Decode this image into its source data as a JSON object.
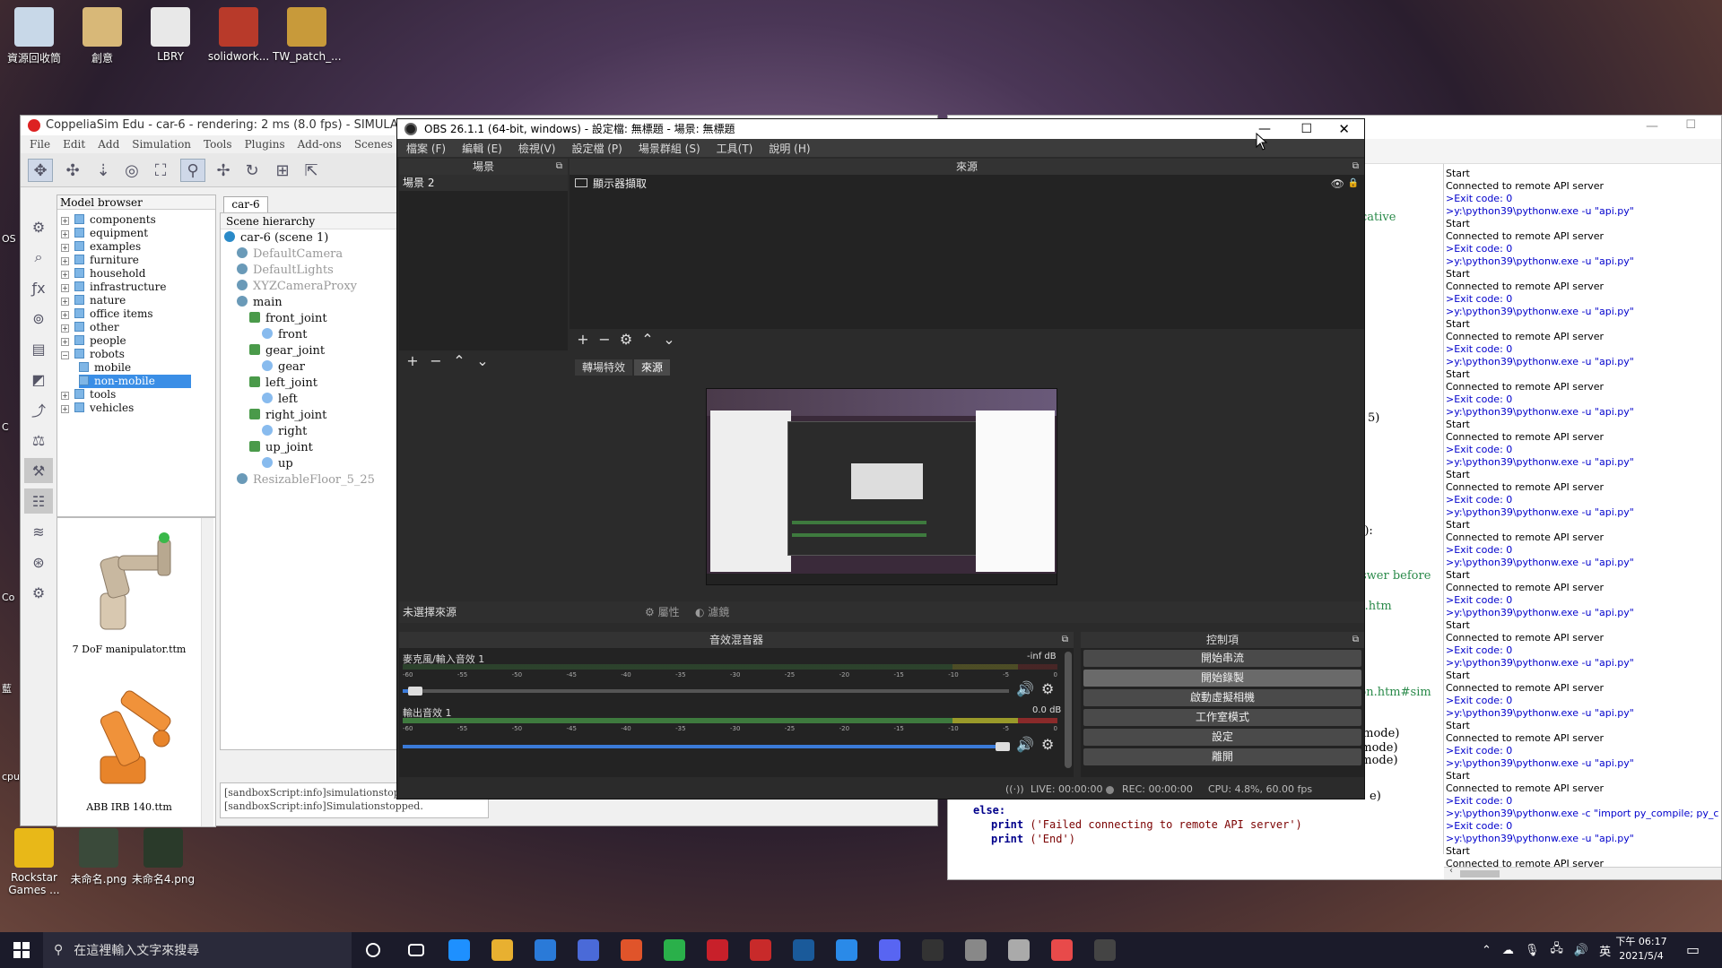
{
  "desktop": {
    "icons_top": [
      {
        "label": "資源回收筒",
        "color": "#c8d8e8"
      },
      {
        "label": "創意",
        "color": "#d8b878"
      },
      {
        "label": "LBRY",
        "color": "#e8e8e8"
      },
      {
        "label": "solidwork...",
        "color": "#b83a2a"
      },
      {
        "label": "TW_patch_...",
        "color": "#c89a3a"
      }
    ],
    "icons_bottom": [
      {
        "label": "Rockstar\nGames ...",
        "color": "#e8b818"
      },
      {
        "label": "未命名.png",
        "color": "#3a4a3a"
      },
      {
        "label": "未命名4.png",
        "color": "#2a3a2a"
      }
    ],
    "left_labels": [
      "OS",
      "C",
      "Co",
      "藍",
      "cpu"
    ]
  },
  "coppelia": {
    "title": "CoppeliaSim Edu - car-6 - rendering: 2 ms (8.0 fps) - SIMULATION ST",
    "menu": [
      "File",
      "Edit",
      "Add",
      "Simulation",
      "Tools",
      "Plugins",
      "Add-ons",
      "Scenes",
      "Help"
    ],
    "model_browser": {
      "header": "Model browser",
      "items": [
        "components",
        "equipment",
        "examples",
        "furniture",
        "household",
        "infrastructure",
        "nature",
        "office items",
        "other",
        "people",
        "robots",
        "mobile",
        "non-mobile",
        "tools",
        "vehicles"
      ],
      "selected": "non-mobile",
      "thumbs": [
        "7 DoF manipulator.ttm",
        "ABB IRB 140.ttm"
      ]
    },
    "scene": {
      "tab": "car-6",
      "header": "Scene hierarchy",
      "items": [
        {
          "label": "car-6 (scene 1)",
          "indent": 0,
          "dim": false
        },
        {
          "label": "DefaultCamera",
          "indent": 1,
          "dim": true
        },
        {
          "label": "DefaultLights",
          "indent": 1,
          "dim": true
        },
        {
          "label": "XYZCameraProxy",
          "indent": 1,
          "dim": true
        },
        {
          "label": "main",
          "indent": 1,
          "dim": false
        },
        {
          "label": "front_joint",
          "indent": 2,
          "dim": false
        },
        {
          "label": "front",
          "indent": 3,
          "dim": false
        },
        {
          "label": "gear_joint",
          "indent": 2,
          "dim": false
        },
        {
          "label": "gear",
          "indent": 3,
          "dim": false
        },
        {
          "label": "left_joint",
          "indent": 2,
          "dim": false
        },
        {
          "label": "left",
          "indent": 3,
          "dim": false
        },
        {
          "label": "right_joint",
          "indent": 2,
          "dim": false
        },
        {
          "label": "right",
          "indent": 3,
          "dim": false
        },
        {
          "label": "up_joint",
          "indent": 2,
          "dim": false
        },
        {
          "label": "up",
          "indent": 3,
          "dim": false
        },
        {
          "label": "ResizableFloor_5_25",
          "indent": 1,
          "dim": true
        }
      ]
    },
    "log": [
      "[sandboxScript:info]simulationstopping",
      "[sandboxScript:info]Simulationstopped."
    ]
  },
  "obs": {
    "title": "OBS 26.1.1 (64-bit, windows) - 設定檔: 無標題 - 場景: 無標題",
    "menu": [
      "檔案 (F)",
      "編輯 (E)",
      "檢視(V)",
      "設定檔 (P)",
      "場景群組 (S)",
      "工具(T)",
      "說明 (H)"
    ],
    "scenes_header": "場景",
    "scene_item": "場景 2",
    "sources_header": "來源",
    "source_item": "顯示器擷取",
    "tabs": [
      "轉場特效",
      "來源"
    ],
    "no_source": "未選擇來源",
    "properties": "屬性",
    "filters": "濾鏡",
    "mixer_header": "音效混音器",
    "mic_label": "麥克風/輸入音效 1",
    "mic_db": "-inf dB",
    "desktop_label": "輸出音效 1",
    "desktop_db": "0.0 dB",
    "mic_volume": 0.02,
    "desktop_volume": 0.99,
    "scale": [
      "-60",
      "-55",
      "-50",
      "-45",
      "-40",
      "-35",
      "-30",
      "-25",
      "-20",
      "-15",
      "-10",
      "-5",
      "0"
    ],
    "controls_header": "控制項",
    "controls": [
      "開始串流",
      "開始錄製",
      "啟動虛擬相機",
      "工作室模式",
      "設定",
      "離開"
    ],
    "status": {
      "live": "LIVE: 00:00:00",
      "rec": "REC: 00:00:00",
      "cpu": "CPU: 4.8%, 60.00 fps"
    }
  },
  "console": {
    "lines": [
      {
        "t": "Start",
        "c": "#000"
      },
      {
        "t": "Connected to remote API server",
        "c": "#000"
      },
      {
        "t": ">Exit code: 0",
        "c": "#0000cc"
      },
      {
        "t": ">y:\\python39\\pythonw.exe -u \"api.py\"",
        "c": "#0000cc"
      },
      {
        "t": "Start",
        "c": "#000"
      },
      {
        "t": "Connected to remote API server",
        "c": "#000"
      },
      {
        "t": ">Exit code: 0",
        "c": "#0000cc"
      },
      {
        "t": ">y:\\python39\\pythonw.exe -u \"api.py\"",
        "c": "#0000cc"
      },
      {
        "t": "Start",
        "c": "#000"
      },
      {
        "t": "Connected to remote API server",
        "c": "#000"
      },
      {
        "t": ">Exit code: 0",
        "c": "#0000cc"
      },
      {
        "t": ">y:\\python39\\pythonw.exe -u \"api.py\"",
        "c": "#0000cc"
      },
      {
        "t": "Start",
        "c": "#000"
      },
      {
        "t": "Connected to remote API server",
        "c": "#000"
      },
      {
        "t": ">Exit code: 0",
        "c": "#0000cc"
      },
      {
        "t": ">y:\\python39\\pythonw.exe -u \"api.py\"",
        "c": "#0000cc"
      },
      {
        "t": "Start",
        "c": "#000"
      },
      {
        "t": "Connected to remote API server",
        "c": "#000"
      },
      {
        "t": ">Exit code: 0",
        "c": "#0000cc"
      },
      {
        "t": ">y:\\python39\\pythonw.exe -u \"api.py\"",
        "c": "#0000cc"
      },
      {
        "t": "Start",
        "c": "#000"
      },
      {
        "t": "Connected to remote API server",
        "c": "#000"
      },
      {
        "t": ">Exit code: 0",
        "c": "#0000cc"
      },
      {
        "t": ">y:\\python39\\pythonw.exe -u \"api.py\"",
        "c": "#0000cc"
      },
      {
        "t": "Start",
        "c": "#000"
      },
      {
        "t": "Connected to remote API server",
        "c": "#000"
      },
      {
        "t": ">Exit code: 0",
        "c": "#0000cc"
      },
      {
        "t": ">y:\\python39\\pythonw.exe -u \"api.py\"",
        "c": "#0000cc"
      },
      {
        "t": "Start",
        "c": "#000"
      },
      {
        "t": "Connected to remote API server",
        "c": "#000"
      },
      {
        "t": ">Exit code: 0",
        "c": "#0000cc"
      },
      {
        "t": ">y:\\python39\\pythonw.exe -u \"api.py\"",
        "c": "#0000cc"
      },
      {
        "t": "Start",
        "c": "#000"
      },
      {
        "t": "Connected to remote API server",
        "c": "#000"
      },
      {
        "t": ">Exit code: 0",
        "c": "#0000cc"
      },
      {
        "t": ">y:\\python39\\pythonw.exe -u \"api.py\"",
        "c": "#0000cc"
      },
      {
        "t": "Start",
        "c": "#000"
      },
      {
        "t": "Connected to remote API server",
        "c": "#000"
      },
      {
        "t": ">Exit code: 0",
        "c": "#0000cc"
      },
      {
        "t": ">y:\\python39\\pythonw.exe -u \"api.py\"",
        "c": "#0000cc"
      },
      {
        "t": "Start",
        "c": "#000"
      },
      {
        "t": "Connected to remote API server",
        "c": "#000"
      },
      {
        "t": ">Exit code: 0",
        "c": "#0000cc"
      },
      {
        "t": ">y:\\python39\\pythonw.exe -u \"api.py\"",
        "c": "#0000cc"
      },
      {
        "t": "Start",
        "c": "#000"
      },
      {
        "t": "Connected to remote API server",
        "c": "#000"
      },
      {
        "t": ">Exit code: 0",
        "c": "#0000cc"
      },
      {
        "t": ">y:\\python39\\pythonw.exe -u \"api.py\"",
        "c": "#0000cc"
      },
      {
        "t": "Start",
        "c": "#000"
      },
      {
        "t": "Connected to remote API server",
        "c": "#000"
      },
      {
        "t": ">Exit code: 0",
        "c": "#0000cc"
      },
      {
        "t": ">y:\\python39\\pythonw.exe -c \"import py_compile; py_c",
        "c": "#0000cc"
      },
      {
        "t": ">Exit code: 0",
        "c": "#0000cc"
      },
      {
        "t": ">y:\\python39\\pythonw.exe -u \"api.py\"",
        "c": "#0000cc"
      },
      {
        "t": "Start",
        "c": "#000"
      },
      {
        "t": "Connected to remote API server",
        "c": "#000"
      },
      {
        "t": ">Exit code: 0",
        "c": "#0000cc"
      }
    ],
    "fragments": [
      {
        "t": "cative",
        "c": "#2a8a4a"
      },
      {
        "t": "5)",
        "c": "#000"
      },
      {
        "t": "g):",
        "c": "#000"
      },
      {
        "t": "swer before",
        "c": "#2a8a4a"
      },
      {
        "t": "s.htm",
        "c": "#2a8a4a"
      },
      {
        "t": "non.htm#sim",
        "c": "#2a8a4a"
      },
      {
        "t": "opmode)",
        "c": "#000"
      },
      {
        "t": ",opmode)",
        "c": "#000"
      },
      {
        "t": ",opmode)",
        "c": "#000"
      },
      {
        "t": "e)",
        "c": "#000"
      }
    ],
    "code": [
      {
        "k": "else:",
        "s": ""
      },
      {
        "k": "print",
        "s": "('Failed connecting to remote API server')"
      },
      {
        "k": "print",
        "s": "('End')"
      }
    ]
  },
  "taskbar": {
    "search_placeholder": "在這裡輸入文字來搜尋",
    "apps": [
      "#1e90ff",
      "#e8b030",
      "#2a7ad8",
      "#4a6ad8",
      "#e0542a",
      "#2ab04a",
      "#c8202a",
      "#c82a2a",
      "#1a5a9a",
      "#2a8ae8",
      "#5865f2",
      "#333333",
      "#888888",
      "#aaaaaa",
      "#e84a4a",
      "#444444"
    ],
    "ime": "英",
    "time": "下午 06:17",
    "date": "2021/5/4"
  }
}
